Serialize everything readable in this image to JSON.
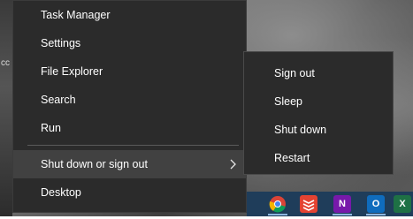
{
  "desktop": {
    "edge_text": "cc"
  },
  "context_menu": {
    "items": [
      {
        "label": "Task Manager"
      },
      {
        "label": "Settings"
      },
      {
        "label": "File Explorer"
      },
      {
        "label": "Search"
      },
      {
        "label": "Run"
      },
      {
        "label": "Shut down or sign out"
      },
      {
        "label": "Desktop"
      }
    ]
  },
  "submenu": {
    "items": [
      {
        "label": "Sign out"
      },
      {
        "label": "Sleep"
      },
      {
        "label": "Shut down"
      },
      {
        "label": "Restart"
      }
    ]
  },
  "taskbar": {
    "icons": [
      {
        "name": "chrome-icon",
        "color": "#ffffff"
      },
      {
        "name": "todoist-icon",
        "color": "#e44332"
      },
      {
        "name": "onenote-icon",
        "color": "#7719aa",
        "glyph": "N"
      },
      {
        "name": "outlook-icon",
        "color": "#0f6cbd",
        "glyph": "O"
      },
      {
        "name": "excel-icon",
        "color": "#1e7145",
        "glyph": "X"
      }
    ]
  }
}
